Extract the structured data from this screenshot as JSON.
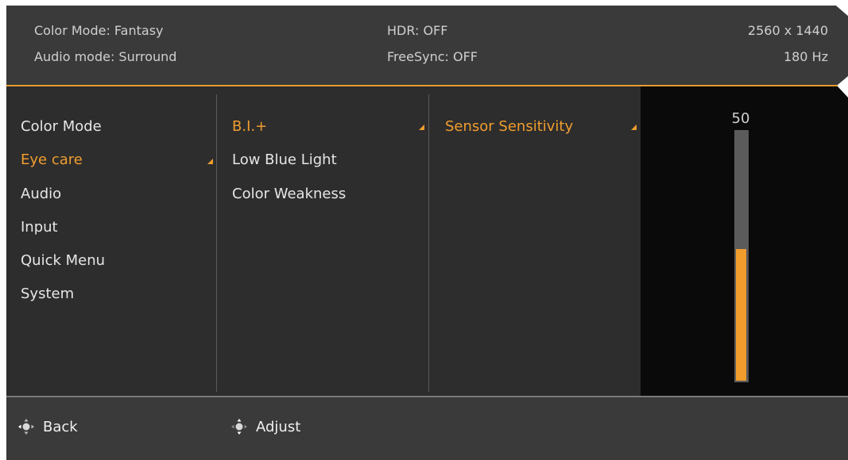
{
  "header": {
    "color_mode": "Color Mode: Fantasy",
    "audio_mode": "Audio mode: Surround",
    "hdr": "HDR: OFF",
    "freesync": "FreeSync: OFF",
    "resolution": "2560 x 1440",
    "refresh_rate": "180 Hz"
  },
  "main_menu": {
    "items": [
      {
        "label": "Color Mode",
        "active": false
      },
      {
        "label": "Eye care",
        "active": true
      },
      {
        "label": "Audio",
        "active": false
      },
      {
        "label": "Input",
        "active": false
      },
      {
        "label": "Quick Menu",
        "active": false
      },
      {
        "label": "System",
        "active": false
      }
    ]
  },
  "sub_menu": {
    "items": [
      {
        "label": "B.I.+",
        "active": true
      },
      {
        "label": "Low Blue Light",
        "active": false
      },
      {
        "label": "Color Weakness",
        "active": false
      }
    ]
  },
  "option_menu": {
    "items": [
      {
        "label": "Sensor Sensitivity",
        "active": true
      }
    ]
  },
  "slider": {
    "value": "50",
    "level_percent": 53
  },
  "footer": {
    "back_label": "Back",
    "adjust_label": "Adjust",
    "back_icon": "joystick-icon",
    "adjust_icon": "joystick-vertical-icon"
  },
  "colors": {
    "accent": "#f09d2e",
    "panel_bg": "#2d2d2d",
    "header_bg": "#3a3a3a",
    "slider_bg": "#0a0a0a"
  }
}
